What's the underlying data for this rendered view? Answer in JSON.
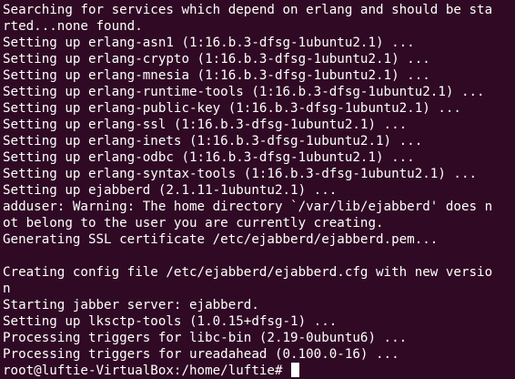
{
  "terminal": {
    "lines": [
      "Searching for services which depend on erlang and should be sta",
      "rted...none found.",
      "Setting up erlang-asn1 (1:16.b.3-dfsg-1ubuntu2.1) ...",
      "Setting up erlang-crypto (1:16.b.3-dfsg-1ubuntu2.1) ...",
      "Setting up erlang-mnesia (1:16.b.3-dfsg-1ubuntu2.1) ...",
      "Setting up erlang-runtime-tools (1:16.b.3-dfsg-1ubuntu2.1) ...",
      "Setting up erlang-public-key (1:16.b.3-dfsg-1ubuntu2.1) ...",
      "Setting up erlang-ssl (1:16.b.3-dfsg-1ubuntu2.1) ...",
      "Setting up erlang-inets (1:16.b.3-dfsg-1ubuntu2.1) ...",
      "Setting up erlang-odbc (1:16.b.3-dfsg-1ubuntu2.1) ...",
      "Setting up erlang-syntax-tools (1:16.b.3-dfsg-1ubuntu2.1) ...",
      "Setting up ejabberd (2.1.11-1ubuntu2.1) ...",
      "adduser: Warning: The home directory `/var/lib/ejabberd' does n",
      "ot belong to the user you are currently creating.",
      "Generating SSL certificate /etc/ejabberd/ejabberd.pem...",
      "",
      "Creating config file /etc/ejabberd/ejabberd.cfg with new versio",
      "n",
      "Starting jabber server: ejabberd.",
      "Setting up lksctp-tools (1.0.15+dfsg-1) ...",
      "Processing triggers for libc-bin (2.19-0ubuntu6) ...",
      "Processing triggers for ureadahead (0.100.0-16) ..."
    ],
    "prompt": "root@luftie-VirtualBox:/home/luftie# "
  },
  "colors": {
    "background": "#300a24",
    "foreground": "#ffffff"
  }
}
